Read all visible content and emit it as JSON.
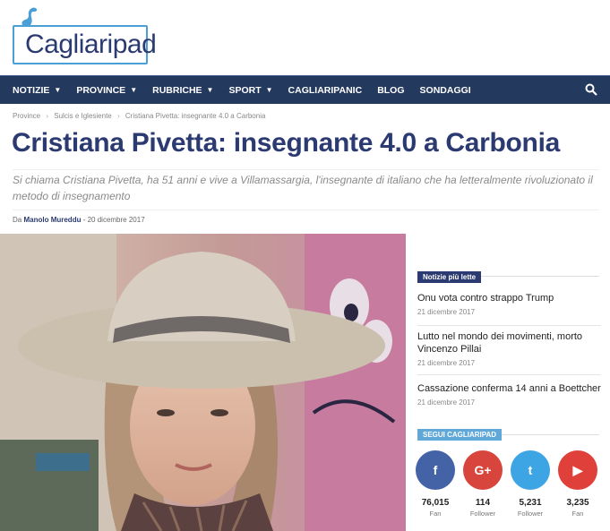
{
  "site": {
    "logo_text": "Cagliaripad"
  },
  "nav": {
    "items": [
      {
        "label": "NOTIZIE",
        "dropdown": true
      },
      {
        "label": "PROVINCE",
        "dropdown": true
      },
      {
        "label": "RUBRICHE",
        "dropdown": true
      },
      {
        "label": "SPORT",
        "dropdown": true
      },
      {
        "label": "CAGLIARIPANIC",
        "dropdown": false
      },
      {
        "label": "BLOG",
        "dropdown": false
      },
      {
        "label": "SONDAGGI",
        "dropdown": false
      }
    ],
    "search_icon": "search-icon"
  },
  "breadcrumb": [
    "Province",
    "Sulcis e Iglesiente",
    "Cristiana Pivetta: insegnante 4.0 a Carbonia"
  ],
  "article": {
    "title": "Cristiana Pivetta: insegnante 4.0 a Carbonia",
    "subtitle": "Si chiama Cristiana Pivetta, ha 51 anni e vive a Villamassargia, l'insegnante di italiano che ha letteralmente rivoluzionato il metodo di insegnamento",
    "by": "Da",
    "author": "Manolo Mureddu",
    "date": "20 dicembre 2017"
  },
  "sidebar": {
    "popular_label": "Notizie più lette",
    "news": [
      {
        "title": "Onu vota contro strappo Trump",
        "date": "21 dicembre 2017"
      },
      {
        "title": "Lutto nel mondo dei movimenti, morto Vincenzo Pillai",
        "date": "21 dicembre 2017"
      },
      {
        "title": "Cassazione conferma 14 anni a Boettcher",
        "date": "21 dicembre 2017"
      }
    ],
    "follow_label": "SEGUI CAGLIARIPAD",
    "social": [
      {
        "glyph": "f",
        "icon": "facebook-icon",
        "count": "76,015",
        "label": "Fan",
        "color": "#4462a6"
      },
      {
        "glyph": "G+",
        "icon": "google-plus-icon",
        "count": "114",
        "label": "Follower",
        "color": "#d8453c"
      },
      {
        "glyph": "t",
        "icon": "twitter-icon",
        "count": "5,231",
        "label": "Follower",
        "color": "#3ea5e4"
      },
      {
        "glyph": "▶",
        "icon": "youtube-icon",
        "count": "3,235",
        "label": "Fan",
        "color": "#e0403a"
      }
    ]
  }
}
